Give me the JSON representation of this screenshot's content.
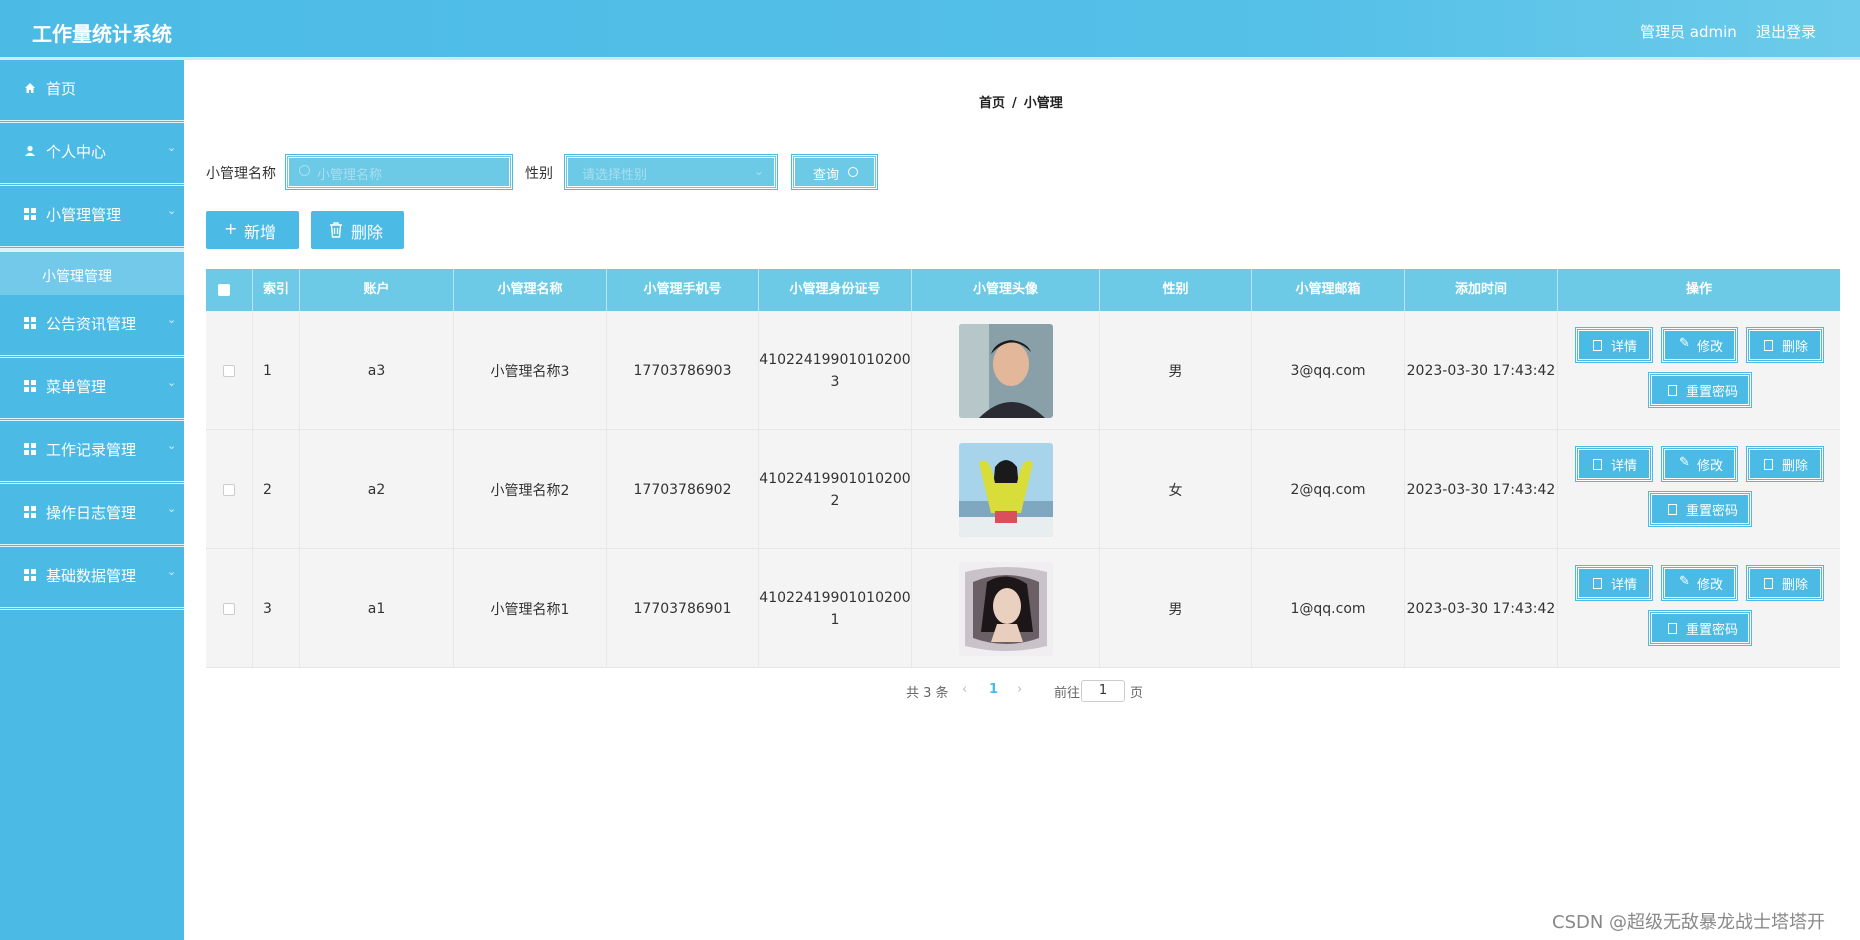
{
  "header": {
    "title": "工作量统计系统",
    "user": "管理员 admin",
    "logout": "退出登录"
  },
  "sidebar": {
    "items": [
      {
        "label": "首页",
        "icon": "home-icon"
      },
      {
        "label": "个人中心",
        "icon": "user-icon"
      },
      {
        "label": "小管理管理",
        "icon": "grid-icon"
      },
      {
        "label": "小管理管理",
        "sub": true
      },
      {
        "label": "公告资讯管理",
        "icon": "grid-icon"
      },
      {
        "label": "菜单管理",
        "icon": "grid-icon"
      },
      {
        "label": "工作记录管理",
        "icon": "grid-icon"
      },
      {
        "label": "操作日志管理",
        "icon": "grid-icon"
      },
      {
        "label": "基础数据管理",
        "icon": "grid-icon"
      }
    ]
  },
  "breadcrumb": {
    "home": "首页",
    "sep": "/",
    "current": "小管理"
  },
  "search": {
    "name_label": "小管理名称",
    "name_placeholder": "小管理名称",
    "gender_label": "性别",
    "gender_placeholder": "请选择性别",
    "query_label": "查询"
  },
  "toolbar": {
    "add_label": "新增",
    "delete_label": "删除"
  },
  "table": {
    "headers": [
      "索引",
      "账户",
      "小管理名称",
      "小管理手机号",
      "小管理身份证号",
      "小管理头像",
      "性别",
      "小管理邮箱",
      "添加时间",
      "操作"
    ],
    "rows": [
      {
        "index": "1",
        "account": "a3",
        "name": "小管理名称3",
        "phone": "17703786903",
        "id_line1": "41022419901010200",
        "id_line2": "3",
        "gender": "男",
        "email": "3@qq.com",
        "time": "2023-03-30 17:43:42"
      },
      {
        "index": "2",
        "account": "a2",
        "name": "小管理名称2",
        "phone": "17703786902",
        "id_line1": "41022419901010200",
        "id_line2": "2",
        "gender": "女",
        "email": "2@qq.com",
        "time": "2023-03-30 17:43:42"
      },
      {
        "index": "3",
        "account": "a1",
        "name": "小管理名称1",
        "phone": "17703786901",
        "id_line1": "41022419901010200",
        "id_line2": "1",
        "gender": "男",
        "email": "1@qq.com",
        "time": "2023-03-30 17:43:42"
      }
    ],
    "actions": {
      "detail": "详情",
      "edit": "修改",
      "delete": "删除",
      "reset": "重置密码"
    }
  },
  "pagination": {
    "total": "共 3 条",
    "current_page": "1",
    "goto_label": "前往",
    "goto_value": "1",
    "page_unit": "页"
  },
  "watermark": "CSDN @超级无敌暴龙战士塔塔开",
  "colors": {
    "primary": "#4bbbe6",
    "light": "#6ccae6",
    "row_bg": "#f4f4f4"
  }
}
